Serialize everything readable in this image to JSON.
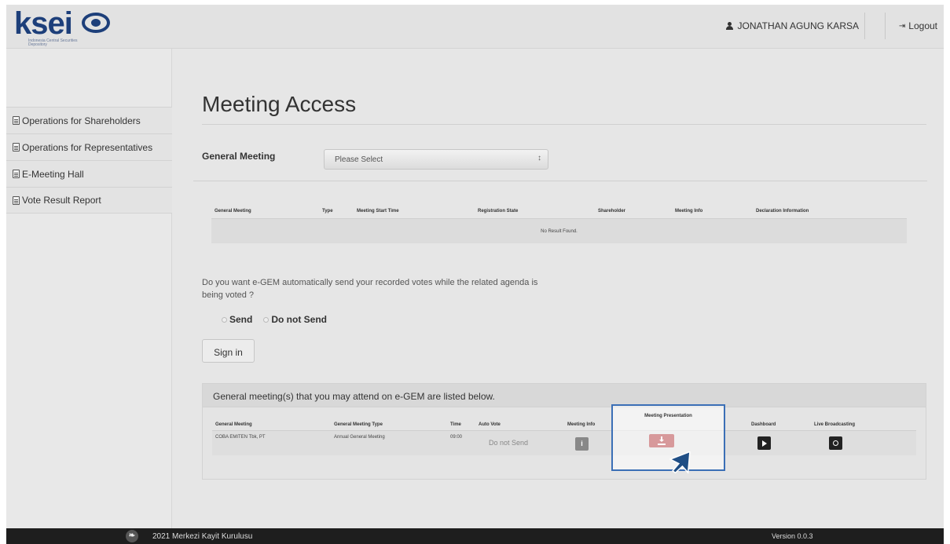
{
  "brand": {
    "logo_text": "ksei",
    "logo_sub": "Indonesia Central Securities Depository"
  },
  "header": {
    "user_name": "JONATHAN AGUNG KARSA",
    "logout_label": "Logout"
  },
  "sidebar": {
    "items": [
      {
        "label": "Operations for Shareholders"
      },
      {
        "label": "Operations for Representatives"
      },
      {
        "label": "E-Meeting Hall"
      },
      {
        "label": "Vote Result Report"
      }
    ]
  },
  "main": {
    "title": "Meeting Access",
    "general_meeting_label": "General Meeting",
    "general_meeting_select": "Please Select",
    "table1": {
      "columns": [
        "General Meeting",
        "Type",
        "Meeting Start Time",
        "Registration State",
        "Shareholder",
        "Meeting Info",
        "Declaration Information"
      ],
      "empty_text": "No Result Found."
    },
    "question": "Do you want e-GEM automatically send your recorded votes while the related agenda is being voted ?",
    "radio_send": "Send",
    "radio_do_not_send": "Do not Send",
    "sign_in_label": "Sign in",
    "panel": {
      "heading": "General meeting(s) that you may attend on e-GEM are listed below.",
      "columns": [
        "General Meeting",
        "General Meeting Type",
        "Time",
        "Auto Vote",
        "Meeting Info",
        "Meeting Presentation",
        "Dashboard",
        "Live Broadcasting"
      ],
      "row": {
        "general_meeting": "COBA EMITEN Tbk, PT",
        "type": "Annual General Meeting",
        "time": "09:00",
        "auto_vote": "Do not Send"
      }
    }
  },
  "footer": {
    "copyright": "2021 Merkezi Kayit Kurulusu",
    "version": "Version 0.0.3"
  },
  "colors": {
    "accent_red": "#a61e22",
    "highlight_blue": "#3b6fb6",
    "brand_blue": "#1d3f7a"
  },
  "icons": [
    "user-icon",
    "logout-icon",
    "document-icon",
    "info-icon",
    "download-icon",
    "play-icon",
    "live-icon",
    "cursor-arrow-icon"
  ]
}
